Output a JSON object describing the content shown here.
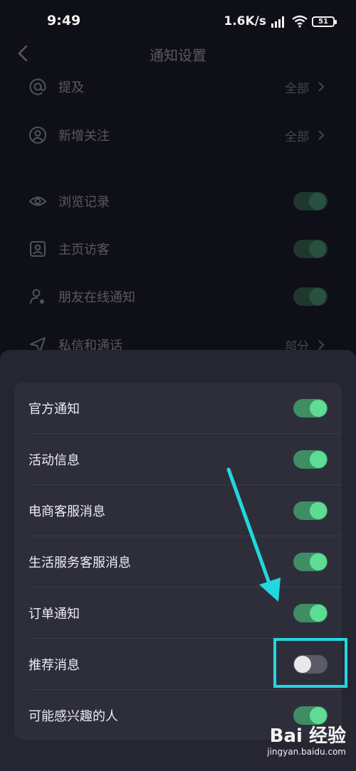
{
  "status": {
    "time": "9:49",
    "net_speed": "1.6K/s",
    "battery": "51"
  },
  "header": {
    "title": "通知设置"
  },
  "background_rows": [
    {
      "label": "提及",
      "value": "全部",
      "type": "link",
      "icon": "at-icon"
    },
    {
      "label": "新增关注",
      "value": "全部",
      "type": "link",
      "icon": "user-circle-icon"
    },
    {
      "label": "浏览记录",
      "type": "toggle",
      "on": true,
      "icon": "eye-icon"
    },
    {
      "label": "主页访客",
      "type": "toggle",
      "on": true,
      "icon": "profile-card-icon"
    },
    {
      "label": "朋友在线通知",
      "type": "toggle",
      "on": true,
      "icon": "friend-online-icon"
    },
    {
      "label": "私信和通话",
      "value": "部分",
      "type": "link",
      "icon": "send-icon"
    }
  ],
  "sheet": {
    "items": [
      {
        "label": "官方通知",
        "on": true
      },
      {
        "label": "活动信息",
        "on": true
      },
      {
        "label": "电商客服消息",
        "on": true
      },
      {
        "label": "生活服务客服消息",
        "on": true
      },
      {
        "label": "订单通知",
        "on": true
      },
      {
        "label": "推荐消息",
        "on": false
      },
      {
        "label": "可能感兴趣的人",
        "on": true
      }
    ]
  },
  "colors": {
    "toggle_on_track": "#3e8d63",
    "toggle_on_knob": "#5fdc93",
    "annotation": "#23d7df"
  },
  "watermark": {
    "brand": "Bai 经验",
    "url": "jingyan.baidu.com"
  }
}
